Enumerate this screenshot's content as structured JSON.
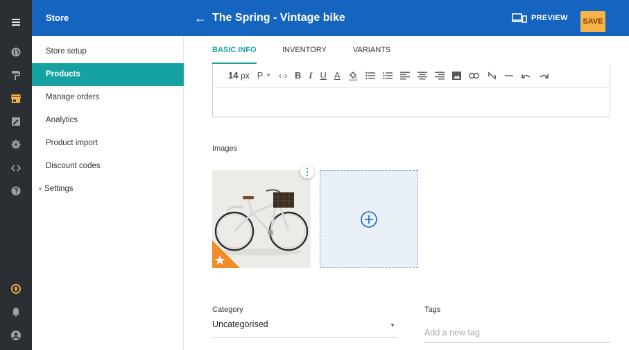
{
  "rail": {
    "items": [
      "menu-icon",
      "globe-icon",
      "paint-roller-icon",
      "store-icon",
      "edit-icon",
      "gear-icon",
      "code-icon",
      "help-icon",
      "upgrade-icon",
      "bell-icon",
      "account-icon"
    ],
    "active_color": "#f7b347"
  },
  "header": {
    "store_title": "Store",
    "page_title": "The Spring - Vintage bike",
    "preview_label": "PREVIEW",
    "save_label": "SAVE",
    "bar_color": "#1565c0"
  },
  "sidebar": {
    "items": [
      {
        "label": "Store setup"
      },
      {
        "label": "Products"
      },
      {
        "label": "Manage orders"
      },
      {
        "label": "Analytics"
      },
      {
        "label": "Product import"
      },
      {
        "label": "Discount codes"
      },
      {
        "label": "Settings"
      }
    ],
    "active_index": 1,
    "accent_color": "#17a2a2"
  },
  "tabs": [
    {
      "label": "BASIC INFO"
    },
    {
      "label": "INVENTORY"
    },
    {
      "label": "VARIANTS"
    }
  ],
  "toolbar": {
    "font_size": "14",
    "font_unit": "px",
    "paragraph": "P"
  },
  "images": {
    "label": "Images"
  },
  "category": {
    "label": "Category",
    "value": "Uncategorised"
  },
  "tags": {
    "label": "Tags",
    "placeholder": "Add a new tag"
  }
}
